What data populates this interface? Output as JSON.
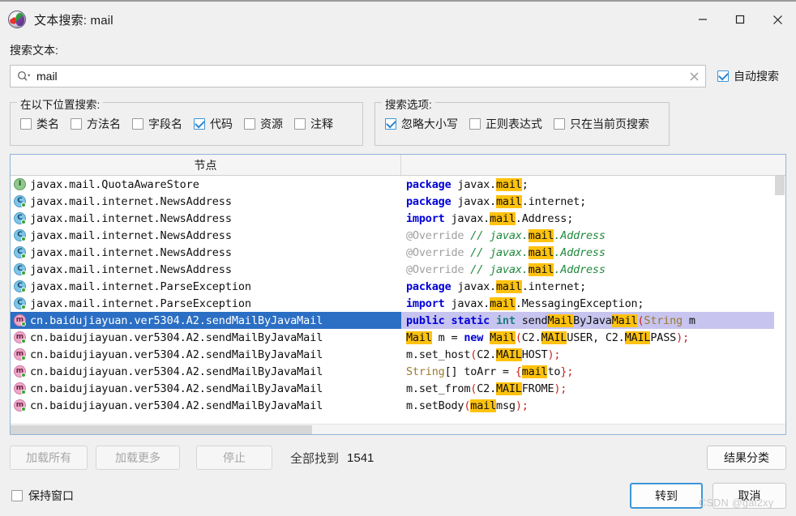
{
  "window": {
    "title": "文本搜索: mail",
    "app_icon": "jd-gui-icon",
    "controls": {
      "minimize": "minimize-icon",
      "maximize": "maximize-icon",
      "close": "close-icon"
    }
  },
  "search": {
    "label": "搜索文本:",
    "value": "mail",
    "placeholder": "",
    "magnifier_icon": "search-icon",
    "clear_icon": "clear-icon",
    "auto_search": {
      "label": "自动搜索",
      "checked": true
    }
  },
  "locations_group": {
    "title": "在以下位置搜索:",
    "items": [
      {
        "label": "类名",
        "checked": false
      },
      {
        "label": "方法名",
        "checked": false
      },
      {
        "label": "字段名",
        "checked": false
      },
      {
        "label": "代码",
        "checked": true
      },
      {
        "label": "资源",
        "checked": false
      },
      {
        "label": "注释",
        "checked": false
      }
    ]
  },
  "options_group": {
    "title": "搜索选项:",
    "items": [
      {
        "label": "忽略大小写",
        "checked": true
      },
      {
        "label": "正则表达式",
        "checked": false
      },
      {
        "label": "只在当前页搜索",
        "checked": false
      }
    ]
  },
  "results": {
    "header": {
      "node": "节点",
      "code": ""
    },
    "rows": [
      {
        "icon": "interface-icon",
        "type": "iface",
        "node": "javax.mail.QuotaAwareStore",
        "selected": false,
        "code": [
          {
            "t": "package ",
            "c": "kw"
          },
          {
            "t": "javax.",
            "c": ""
          },
          {
            "t": "mail",
            "c": "hl"
          },
          {
            "t": ";",
            "c": ""
          }
        ]
      },
      {
        "icon": "class-icon",
        "type": "klass",
        "node": "javax.mail.internet.NewsAddress",
        "selected": false,
        "code": [
          {
            "t": "package ",
            "c": "kw"
          },
          {
            "t": "javax.",
            "c": ""
          },
          {
            "t": "mail",
            "c": "hl"
          },
          {
            "t": ".internet;",
            "c": ""
          }
        ]
      },
      {
        "icon": "class-icon",
        "type": "klass",
        "node": "javax.mail.internet.NewsAddress",
        "selected": false,
        "code": [
          {
            "t": "import ",
            "c": "kw"
          },
          {
            "t": "javax.",
            "c": ""
          },
          {
            "t": "mail",
            "c": "hl"
          },
          {
            "t": ".Address;",
            "c": ""
          }
        ]
      },
      {
        "icon": "class-icon",
        "type": "klass",
        "node": "javax.mail.internet.NewsAddress",
        "selected": false,
        "code": [
          {
            "t": "@Override ",
            "c": "anno"
          },
          {
            "t": "// javax.",
            "c": "cmt"
          },
          {
            "t": "mail",
            "c": "hl"
          },
          {
            "t": ".Address",
            "c": "cmt"
          }
        ]
      },
      {
        "icon": "class-icon",
        "type": "klass",
        "node": "javax.mail.internet.NewsAddress",
        "selected": false,
        "code": [
          {
            "t": "@Override ",
            "c": "anno"
          },
          {
            "t": "// javax.",
            "c": "cmt"
          },
          {
            "t": "mail",
            "c": "hl"
          },
          {
            "t": ".Address",
            "c": "cmt"
          }
        ]
      },
      {
        "icon": "class-icon",
        "type": "klass",
        "node": "javax.mail.internet.NewsAddress",
        "selected": false,
        "code": [
          {
            "t": "@Override ",
            "c": "anno"
          },
          {
            "t": "// javax.",
            "c": "cmt"
          },
          {
            "t": "mail",
            "c": "hl"
          },
          {
            "t": ".Address",
            "c": "cmt"
          }
        ]
      },
      {
        "icon": "class-icon",
        "type": "klass",
        "node": "javax.mail.internet.ParseException",
        "selected": false,
        "code": [
          {
            "t": "package ",
            "c": "kw"
          },
          {
            "t": "javax.",
            "c": ""
          },
          {
            "t": "mail",
            "c": "hl"
          },
          {
            "t": ".internet;",
            "c": ""
          }
        ]
      },
      {
        "icon": "class-icon",
        "type": "klass",
        "node": "javax.mail.internet.ParseException",
        "selected": false,
        "code": [
          {
            "t": "import ",
            "c": "kw"
          },
          {
            "t": "javax.",
            "c": ""
          },
          {
            "t": "mail",
            "c": "hl"
          },
          {
            "t": ".MessagingException;",
            "c": ""
          }
        ]
      },
      {
        "icon": "method-icon",
        "type": "method",
        "node": "cn.baidujiayuan.ver5304.A2.sendMailByJavaMail",
        "selected": true,
        "code": [
          {
            "t": "public static ",
            "c": "kw"
          },
          {
            "t": "int",
            "c": "kw2"
          },
          {
            "t": " send",
            "c": ""
          },
          {
            "t": "Mail",
            "c": "hl"
          },
          {
            "t": "ByJava",
            "c": ""
          },
          {
            "t": "Mail",
            "c": "hl"
          },
          {
            "t": "(",
            "c": "pun"
          },
          {
            "t": "String",
            "c": "typ"
          },
          {
            "t": " m",
            "c": ""
          }
        ]
      },
      {
        "icon": "method-icon",
        "type": "method",
        "node": "cn.baidujiayuan.ver5304.A2.sendMailByJavaMail",
        "selected": false,
        "code": [
          {
            "t": "Mail",
            "c": "hl"
          },
          {
            "t": " m = ",
            "c": ""
          },
          {
            "t": "new",
            "c": "kw"
          },
          {
            "t": " ",
            "c": ""
          },
          {
            "t": "Mail",
            "c": "hl"
          },
          {
            "t": "(",
            "c": "pun"
          },
          {
            "t": "C2.",
            "c": ""
          },
          {
            "t": "MAIL",
            "c": "hl"
          },
          {
            "t": "USER, C2.",
            "c": ""
          },
          {
            "t": "MAIL",
            "c": "hl"
          },
          {
            "t": "PASS",
            "c": ""
          },
          {
            "t": ");",
            "c": "pun"
          }
        ]
      },
      {
        "icon": "method-icon",
        "type": "method",
        "node": "cn.baidujiayuan.ver5304.A2.sendMailByJavaMail",
        "selected": false,
        "code": [
          {
            "t": "m.set_host",
            "c": ""
          },
          {
            "t": "(",
            "c": "pun"
          },
          {
            "t": "C2.",
            "c": ""
          },
          {
            "t": "MAIL",
            "c": "hl"
          },
          {
            "t": "HOST",
            "c": ""
          },
          {
            "t": ");",
            "c": "pun"
          }
        ]
      },
      {
        "icon": "method-icon",
        "type": "method",
        "node": "cn.baidujiayuan.ver5304.A2.sendMailByJavaMail",
        "selected": false,
        "code": [
          {
            "t": "String",
            "c": "typ"
          },
          {
            "t": "[] toArr = ",
            "c": ""
          },
          {
            "t": "{",
            "c": "pun"
          },
          {
            "t": "mail",
            "c": "hl"
          },
          {
            "t": "to",
            "c": ""
          },
          {
            "t": "};",
            "c": "pun"
          }
        ]
      },
      {
        "icon": "method-icon",
        "type": "method",
        "node": "cn.baidujiayuan.ver5304.A2.sendMailByJavaMail",
        "selected": false,
        "code": [
          {
            "t": "m.set_from",
            "c": ""
          },
          {
            "t": "(",
            "c": "pun"
          },
          {
            "t": "C2.",
            "c": ""
          },
          {
            "t": "MAIL",
            "c": "hl"
          },
          {
            "t": "FROME",
            "c": ""
          },
          {
            "t": ");",
            "c": "pun"
          }
        ]
      },
      {
        "icon": "method-icon",
        "type": "method",
        "node": "cn.baidujiayuan.ver5304.A2.sendMailByJavaMail",
        "selected": false,
        "code": [
          {
            "t": "m.setBody",
            "c": ""
          },
          {
            "t": "(",
            "c": "pun"
          },
          {
            "t": "mail",
            "c": "hl"
          },
          {
            "t": "msg",
            "c": ""
          },
          {
            "t": ");",
            "c": "pun"
          }
        ]
      }
    ]
  },
  "bottom": {
    "load_all": "加载所有",
    "load_more": "加载更多",
    "stop": "停止",
    "found_label": "全部找到",
    "found_count": "1541",
    "classify": "结果分类",
    "goto": "转到",
    "cancel": "取消",
    "keep_window": {
      "label": "保持窗口",
      "checked": false
    }
  },
  "watermark": "CSDN @gal2xy",
  "colors": {
    "accent": "#3c96d8",
    "selection_node": "#2b6fc4",
    "selection_code": "#c7c4ef",
    "highlight": "#ffc20e",
    "keyword": "#0000d8",
    "comment": "#1f8a3c"
  }
}
